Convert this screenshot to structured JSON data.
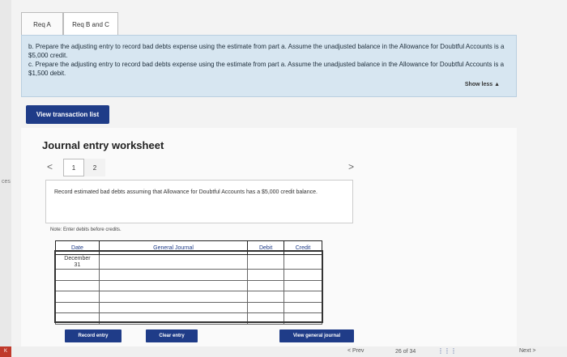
{
  "side": {
    "text": "ces",
    "corner": "K"
  },
  "tabs": [
    {
      "label": "Req A"
    },
    {
      "label": "Req B and C"
    }
  ],
  "instructions": {
    "part_b": "b. Prepare the adjusting entry to record bad debts expense using the estimate from part a. Assume the unadjusted balance in the Allowance for Doubtful Accounts is a $5,000 credit.",
    "part_c": "c. Prepare the adjusting entry to record bad debts expense using the estimate from part a. Assume the unadjusted balance in the Allowance for Doubtful Accounts is a $1,500 debit.",
    "show_less": "Show less ▲"
  },
  "view_transaction_label": "View transaction list",
  "worksheet": {
    "title": "Journal entry worksheet",
    "prev_arrow": "<",
    "next_arrow": ">",
    "pages": [
      "1",
      "2"
    ],
    "description": "Record estimated bad debts assuming that Allowance for Doubtful Accounts has a $5,000 credit balance.",
    "note": "Note: Enter debits before credits.",
    "headers": {
      "date": "Date",
      "general_journal": "General Journal",
      "debit": "Debit",
      "credit": "Credit"
    },
    "date_month": "December",
    "date_day": "31"
  },
  "buttons": {
    "record": "Record entry",
    "clear": "Clear entry",
    "view_general": "View general journal"
  },
  "footer": {
    "prev": "< Prev",
    "count": "26 of 34",
    "grid_icon": "grid-icon",
    "next": "Next >"
  }
}
